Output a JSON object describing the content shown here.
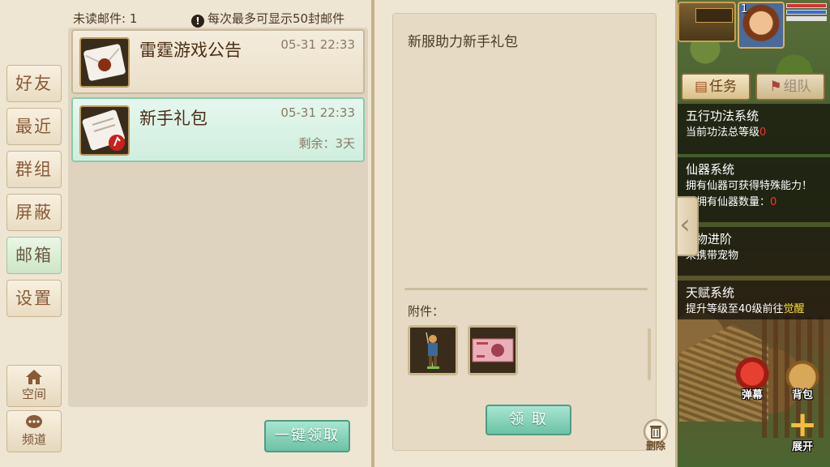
{
  "mail": {
    "unread_label": "未读邮件: 1",
    "limit_notice": "每次最多可显示50封邮件",
    "items": [
      {
        "title": "雷霆游戏公告",
        "time": "05-31 22:33",
        "remaining": ""
      },
      {
        "title": "新手礼包",
        "time": "05-31 22:33",
        "remaining": "剩余：3天"
      }
    ],
    "claim_all_label": "一键领取"
  },
  "sidebar": {
    "tabs": [
      "好友",
      "最近",
      "群组",
      "屏蔽",
      "邮箱",
      "设置"
    ],
    "active_tab": "邮箱",
    "space_label": "空间",
    "channel_label": "频道"
  },
  "detail": {
    "title": "新服助力新手礼包",
    "attachments_label": "附件：",
    "claim_label": "领 取",
    "delete_label": "删除"
  },
  "hud": {
    "level": "1",
    "task_button": "任务",
    "team_button": "组队",
    "tasks": [
      {
        "title": "五行功法系统",
        "desc": "当前功法总等级",
        "value": "0"
      },
      {
        "title": "仙器系统",
        "desc": "拥有仙器可获得特殊能力！",
        "desc2": "前拥有仙器数量：",
        "value": "0"
      },
      {
        "title": "物进阶",
        "desc": "未携带宠物",
        "value": ""
      },
      {
        "title": "天赋系统",
        "desc": "提升等级至40级前往",
        "value": "觉醒"
      }
    ],
    "actions": {
      "barrage": "弹幕",
      "bag": "背包",
      "expand": "展开"
    }
  },
  "colors": {
    "panel_bg": "#efe5d3",
    "active_tab": "#cde6c6",
    "accent_green": "#6cc2a6",
    "text_brown": "#4a2e14"
  }
}
